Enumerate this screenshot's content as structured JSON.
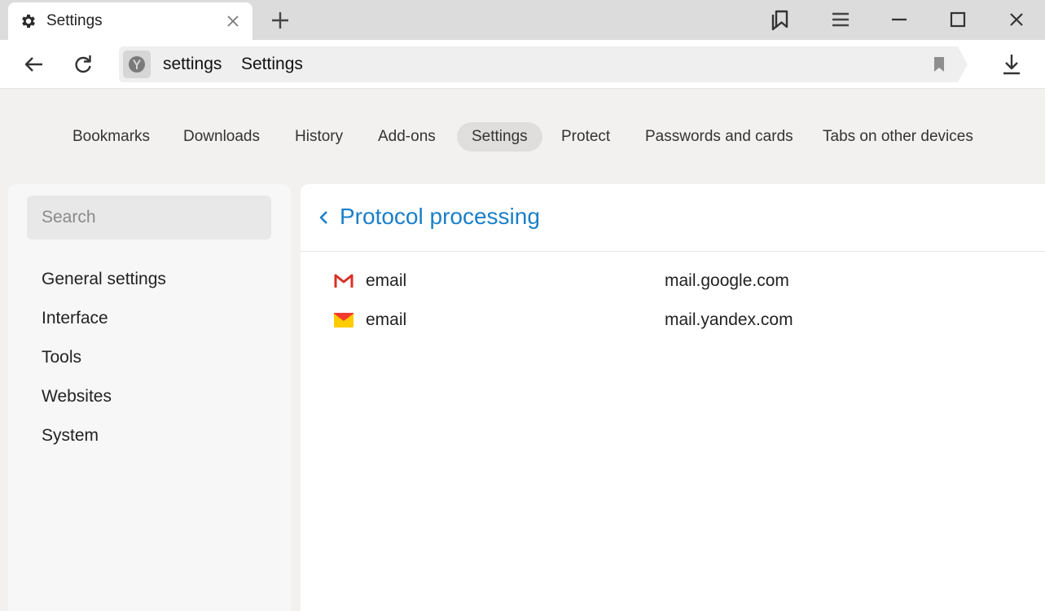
{
  "window": {
    "tab_title": "Settings",
    "tab_icon": "gear-icon"
  },
  "address_bar": {
    "host": "settings",
    "page_title": "Settings"
  },
  "top_nav": {
    "items": [
      {
        "label": "Bookmarks"
      },
      {
        "label": "Downloads"
      },
      {
        "label": "History"
      },
      {
        "label": "Add-ons"
      },
      {
        "label": "Settings",
        "active": true
      },
      {
        "label": "Protect"
      },
      {
        "label": "Passwords and cards"
      },
      {
        "label": "Tabs on other devices"
      }
    ]
  },
  "sidebar": {
    "search_placeholder": "Search",
    "items": [
      {
        "label": "General settings"
      },
      {
        "label": "Interface"
      },
      {
        "label": "Tools"
      },
      {
        "label": "Websites"
      },
      {
        "label": "System"
      }
    ]
  },
  "main": {
    "title": "Protocol processing",
    "handlers": [
      {
        "icon": "gmail-icon",
        "protocol": "email",
        "host": "mail.google.com"
      },
      {
        "icon": "yandex-mail-icon",
        "protocol": "email",
        "host": "mail.yandex.com"
      }
    ]
  },
  "colors": {
    "accent": "#1a7fc9",
    "gmail_red": "#d93025",
    "yandex_yellow": "#ffcc00",
    "yandex_red": "#f33a2e"
  }
}
